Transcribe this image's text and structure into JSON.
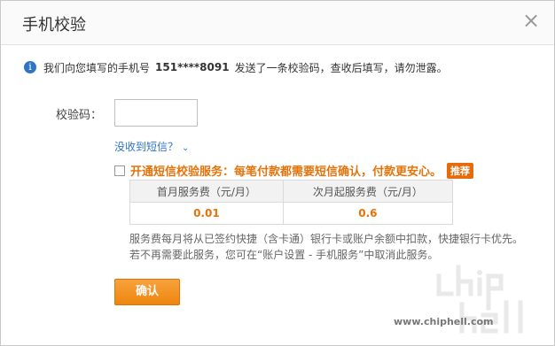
{
  "dialog": {
    "title": "手机校验",
    "close_label": "×"
  },
  "info": {
    "prefix": "我们向您填写的手机号",
    "phone": "151****8091",
    "suffix": "发送了一条校验码，查收后填写，请勿泄露。"
  },
  "verify": {
    "label": "校验码：",
    "value": "",
    "placeholder": ""
  },
  "not_received": {
    "text": "没收到短信？",
    "chevron": "⌄"
  },
  "service": {
    "checked": false,
    "text": "开通短信校验服务：每笔付款都需要短信确认，付款更安心。",
    "badge": "推荐"
  },
  "fees": {
    "headers": [
      "首月服务费（元/月）",
      "次月起服务费（元/月）"
    ],
    "values": [
      "0.01",
      "0.6"
    ]
  },
  "note": {
    "line1": "服务费每月将从已签约快捷（含卡通）银行卡或账户余额中扣款，快捷银行卡优先。",
    "line2": "若不再需要此服务，您可在“账户设置 - 手机服务”中取消此服务。"
  },
  "confirm": {
    "label": "确认"
  },
  "watermark": {
    "url": "www.chiphell.com"
  },
  "colors": {
    "accent": "#e5730a",
    "link": "#2f74c7",
    "button": "#ef8610"
  }
}
